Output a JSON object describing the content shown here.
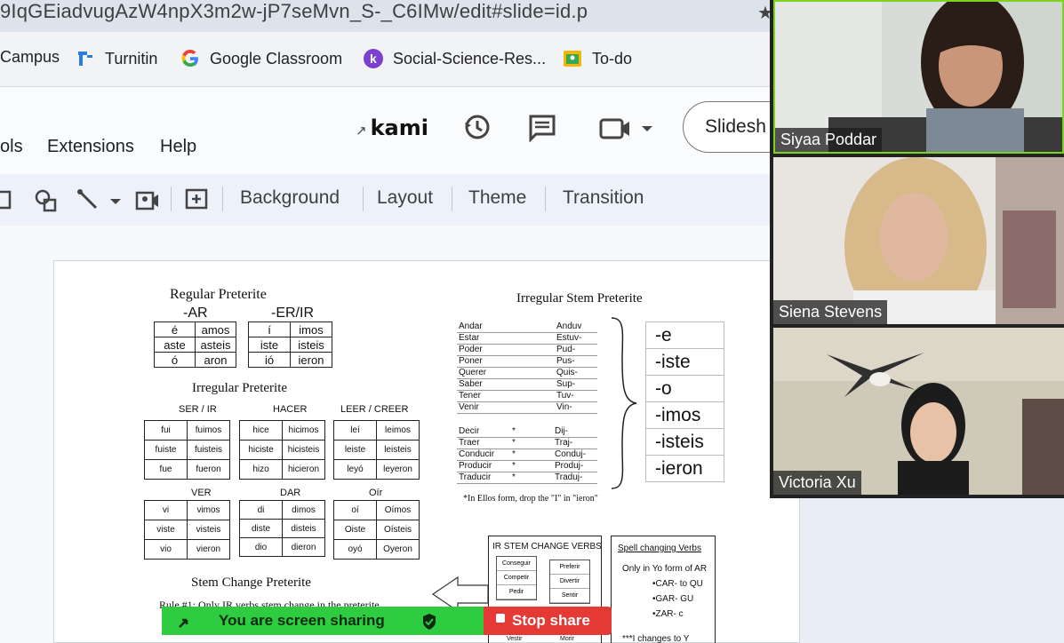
{
  "browser": {
    "url_fragment": "9IqGEiadvugAzW4npX3m2w-jP7seMvn_S-_C6IMw/edit#slide=id.p",
    "bookmarks": [
      {
        "label": "Campus",
        "icon": "campus-icon"
      },
      {
        "label": "Turnitin",
        "icon": "turnitin-icon"
      },
      {
        "label": "Google Classroom",
        "icon": "google-icon"
      },
      {
        "label": "Social-Science-Res...",
        "icon": "k-icon"
      },
      {
        "label": "To-do",
        "icon": "todo-icon"
      }
    ]
  },
  "app": {
    "menus": [
      "ols",
      "Extensions",
      "Help"
    ],
    "kami_label": "kami",
    "slideshow_label": "Slidesh",
    "toolbar_items": [
      "Background",
      "Layout",
      "Theme",
      "Transition"
    ]
  },
  "slide": {
    "regular_title": "Regular Preterite",
    "ar_label": "-AR",
    "erir_label": "-ER/IR",
    "ar_rows": [
      [
        "é",
        "amos"
      ],
      [
        "aste",
        "asteis"
      ],
      [
        "ó",
        "aron"
      ]
    ],
    "erir_rows": [
      [
        "í",
        "imos"
      ],
      [
        "iste",
        "isteis"
      ],
      [
        "ió",
        "ieron"
      ]
    ],
    "irregular_title": "Irregular Preterite",
    "ser_label": "SER / IR",
    "ser_rows": [
      [
        "fui",
        "fuimos"
      ],
      [
        "fuiste",
        "fuisteis"
      ],
      [
        "fue",
        "fueron"
      ]
    ],
    "hacer_label": "HACER",
    "hacer_rows": [
      [
        "hice",
        "hicimos"
      ],
      [
        "hiciste",
        "hicisteis"
      ],
      [
        "hizo",
        "hicieron"
      ]
    ],
    "leer_label": "LEER / CREER",
    "leer_rows": [
      [
        "leí",
        "leimos"
      ],
      [
        "leiste",
        "leisteis"
      ],
      [
        "leyó",
        "leyeron"
      ]
    ],
    "ver_label": "VER",
    "ver_rows": [
      [
        "vi",
        "vimos"
      ],
      [
        "viste",
        "visteis"
      ],
      [
        "vio",
        "vieron"
      ]
    ],
    "dar_label": "DAR",
    "dar_rows": [
      [
        "di",
        "dimos"
      ],
      [
        "diste",
        "disteis"
      ],
      [
        "dio",
        "dieron"
      ]
    ],
    "oir_label": "Oír",
    "oir_rows": [
      [
        "oí",
        "Oímos"
      ],
      [
        "Oiste",
        "Oísteis"
      ],
      [
        "oyó",
        "Oyeron"
      ]
    ],
    "stem_change_title": "Stem Change Preterite",
    "rule1": "Rule #1:  Only IR verbs stem change in the preterite",
    "irr_stem_title": "Irregular Stem Preterite",
    "stem_rows": [
      [
        "Andar",
        "Anduv"
      ],
      [
        "Estar",
        "Estuv-"
      ],
      [
        "Poder",
        "Pud-"
      ],
      [
        "Poner",
        "Pus-"
      ],
      [
        "Querer",
        "Quis-"
      ],
      [
        "Saber",
        "Sup-"
      ],
      [
        "Tener",
        "Tuv-"
      ],
      [
        "Venir",
        "Vin-"
      ]
    ],
    "j_rows": [
      [
        "Decir",
        "*",
        "Dij-"
      ],
      [
        "Traer",
        "*",
        "Traj-"
      ],
      [
        "Conducir",
        "*",
        "Conduj-"
      ],
      [
        "Producir",
        "*",
        "Produj-"
      ],
      [
        "Traducir",
        "*",
        "Traduj-"
      ]
    ],
    "endings": [
      "-e",
      "-iste",
      "-o",
      "-imos",
      "-isteis",
      "-ieron"
    ],
    "footnote": "*In Ellos form, drop the \"I\" in \"ieron\"",
    "ir_stem_title": "IR STEM CHANGE  VERBS",
    "ir_stem_left": [
      "Conseguir",
      "Competir",
      "Pedir"
    ],
    "ir_stem_right": [
      "Preferir",
      "Divertir",
      "Sentir"
    ],
    "ir_stem_bottom": [
      "Vestir",
      "Morir"
    ],
    "spell_title": "Spell changing Verbs",
    "spell_only": "Only in Yo form of AR",
    "spell_rules": [
      "•CAR- to QU",
      "•GAR- GU",
      "•ZAR- c"
    ],
    "spell_more": "***I changes to Y"
  },
  "sharing": {
    "sharing_label": "You are screen sharing",
    "stop_label": "Stop share"
  },
  "participants": [
    {
      "name": "Siyaa Poddar"
    },
    {
      "name": "Siena Stevens"
    },
    {
      "name": "Victoria Xu"
    }
  ]
}
